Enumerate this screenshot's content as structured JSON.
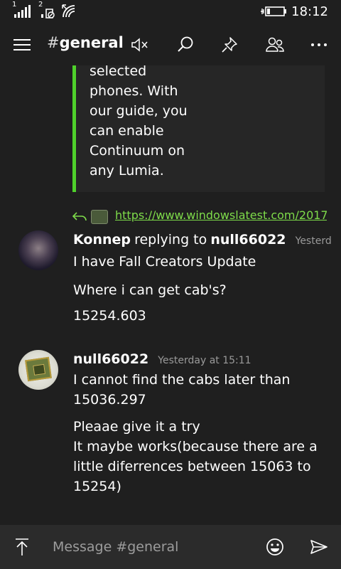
{
  "status_bar": {
    "signal_1_label": "1",
    "signal_2_label": "2",
    "time": "18:12"
  },
  "header": {
    "hash": "#",
    "channel": "general",
    "icons": [
      "menu-icon",
      "mute-icon",
      "search-icon",
      "pin-icon",
      "members-icon",
      "more-icon"
    ]
  },
  "embed": {
    "lines": [
      "selected",
      "phones. With",
      "our guide, you",
      "can enable",
      "Continuum on",
      "any Lumia."
    ],
    "accent": "#4fd12b"
  },
  "link": {
    "url": "https://www.windowslatest.com/2017"
  },
  "messages": [
    {
      "author": "Konnep",
      "replying": "replying to",
      "reply_target": "null66022",
      "timestamp": "Yesterd",
      "lines": [
        "I have Fall Creators Update",
        "Where i can get cab's?",
        "15254.603"
      ]
    },
    {
      "author": "null66022",
      "timestamp": "Yesterday at 15:11",
      "lines": [
        "I cannot find the cabs later than",
        "15036.297",
        "Pleaae give it a try",
        "It maybe works(because there are a",
        "little diferrences between 15063 to",
        "15254)"
      ]
    }
  ],
  "composer": {
    "placeholder": "Message #general"
  },
  "colors": {
    "background": "#1f1f1f",
    "link": "#7edc4a",
    "composer": "#2b2b2b"
  }
}
